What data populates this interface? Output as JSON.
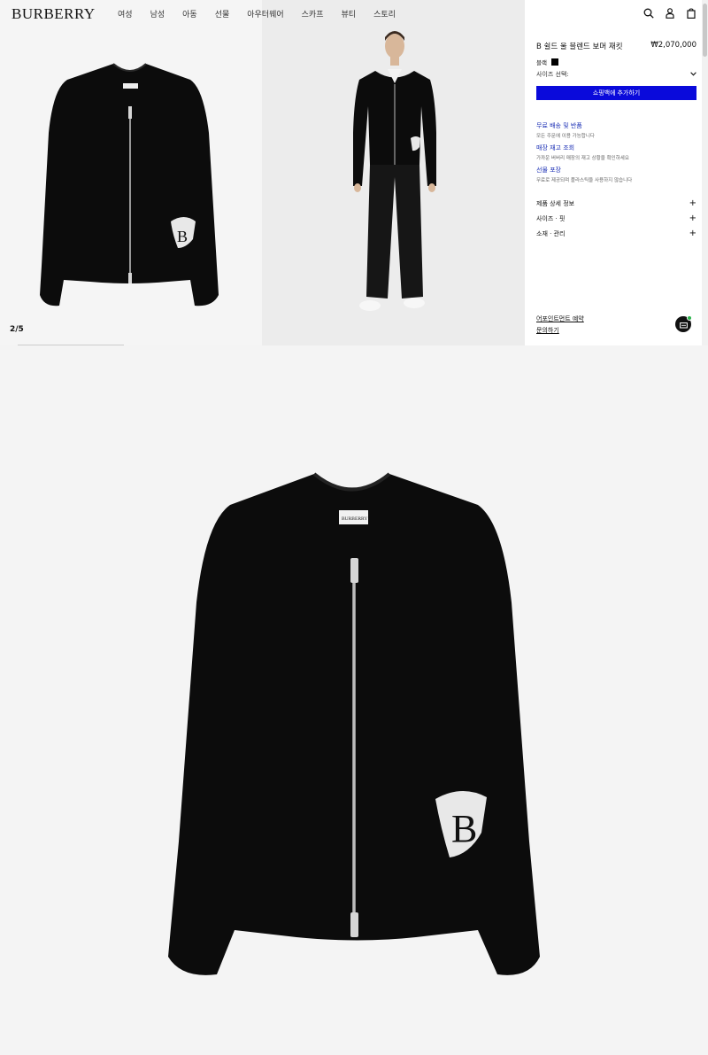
{
  "header": {
    "logo": "BURBERRY",
    "nav": [
      "여성",
      "남성",
      "아동",
      "선물",
      "아우터웨어",
      "스카프",
      "뷰티",
      "스토리"
    ],
    "icons": [
      "search-icon",
      "account-icon",
      "bag-icon"
    ]
  },
  "gallery": {
    "counter": "2/5",
    "current_index": 2,
    "total": 5
  },
  "product": {
    "title": "B 쉴드 울 블렌드 보머 재킷",
    "price": "₩2,070,000",
    "color_label": "블랙",
    "color_hex": "#000000",
    "size_placeholder": "사이즈 선택:",
    "add_to_bag": "쇼핑백에 추가하기"
  },
  "info": [
    {
      "title": "무료 배송 및 반품",
      "sub": "모든 주문에 이용 가능합니다"
    },
    {
      "title": "매장 재고 조회",
      "sub": "가까운 버버리 매장의 재고 상황을 확인하세요"
    },
    {
      "title": "선물 포장",
      "sub": "무료로 제공되며 플라스틱을 사용하지 않습니다"
    }
  ],
  "accordions": [
    "제품 상세 정보",
    "사이즈 · 핏",
    "소재 · 관리"
  ],
  "links": {
    "appointment": "어포인트먼트 예약",
    "inquiry": "문의하기"
  },
  "colors": {
    "accent": "#0a0adb",
    "link": "#1b2fb5",
    "garment": "#0c0c0c",
    "chat_status": "#2bb34a"
  }
}
